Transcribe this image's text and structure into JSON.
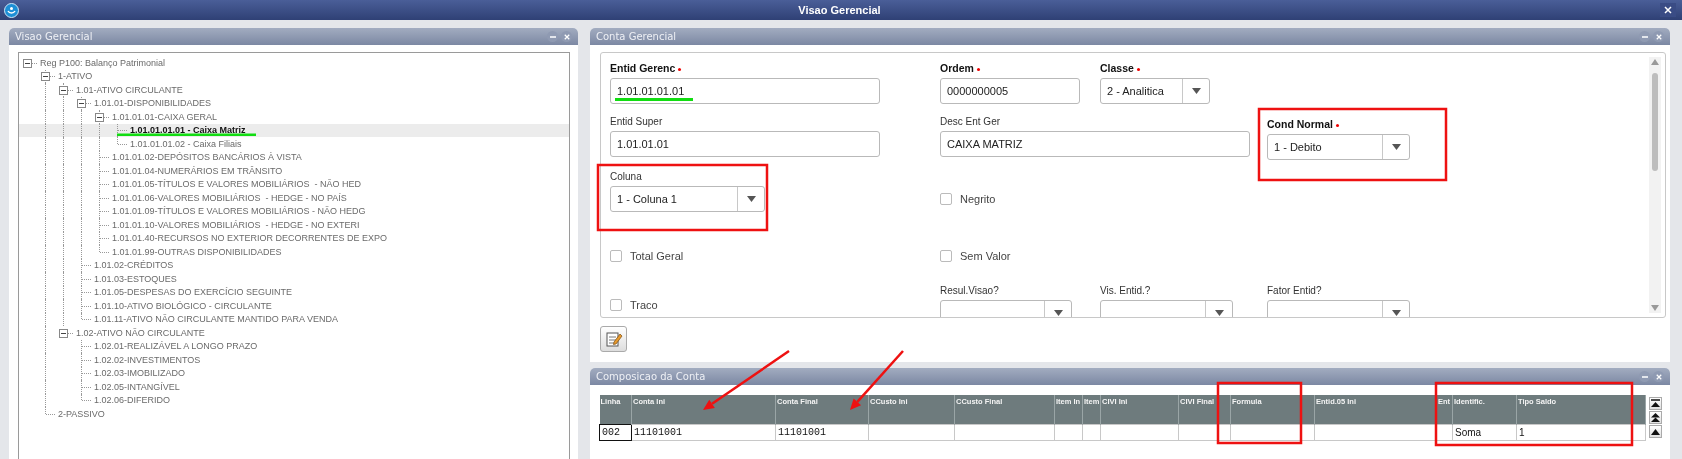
{
  "window": {
    "title": "Visao Gerencial"
  },
  "tree_panel": {
    "title": "Visao Gerencial",
    "tree": [
      {
        "label": "Reg P100: Balanço Patrimonial",
        "expanded": true,
        "selected": false,
        "children": [
          {
            "label": "1-ATIVO",
            "expanded": true,
            "selected": false,
            "children": [
              {
                "label": "1.01-ATIVO CIRCULANTE",
                "expanded": true,
                "selected": false,
                "children": [
                  {
                    "label": "1.01.01-DISPONIBILIDADES",
                    "expanded": true,
                    "selected": false,
                    "children": [
                      {
                        "label": "1.01.01.01-CAIXA GERAL",
                        "expanded": true,
                        "selected": false,
                        "children": [
                          {
                            "label": "1.01.01.01.01 - Caixa Matriz",
                            "selected": true
                          },
                          {
                            "label": "1.01.01.01.02 - Caixa Filiais",
                            "selected": false
                          }
                        ]
                      },
                      {
                        "label": "1.01.01.02-DEPÓSITOS BANCÁRIOS À VISTA",
                        "selected": false
                      },
                      {
                        "label": "1.01.01.04-NUMERÁRIOS EM TRÂNSITO",
                        "selected": false
                      },
                      {
                        "label": "1.01.01.05-TÍTULOS E VALORES MOBILIÁRIOS  - NÃO HED",
                        "selected": false
                      },
                      {
                        "label": "1.01.01.06-VALORES MOBILIÁRIOS  - HEDGE - NO PAÍS",
                        "selected": false
                      },
                      {
                        "label": "1.01.01.09-TÍTULOS E VALORES MOBILIÁRIOS - NÃO HEDG",
                        "selected": false
                      },
                      {
                        "label": "1.01.01.10-VALORES MOBILIÁRIOS  - HEDGE - NO EXTERI",
                        "selected": false
                      },
                      {
                        "label": "1.01.01.40-RECURSOS NO EXTERIOR DECORRENTES DE EXPO",
                        "selected": false
                      },
                      {
                        "label": "1.01.01.99-OUTRAS DISPONIBILIDADES",
                        "selected": false
                      }
                    ]
                  },
                  {
                    "label": "1.01.02-CRÉDITOS",
                    "selected": false
                  },
                  {
                    "label": "1.01.03-ESTOQUES",
                    "selected": false
                  },
                  {
                    "label": "1.01.05-DESPESAS DO EXERCÍCIO SEGUINTE",
                    "selected": false
                  },
                  {
                    "label": "1.01.10-ATIVO BIOLÓGICO - CIRCULANTE",
                    "selected": false
                  },
                  {
                    "label": "1.01.11-ATIVO NÃO CIRCULANTE MANTIDO PARA VENDA",
                    "selected": false
                  }
                ]
              },
              {
                "label": "1.02-ATIVO NÃO CIRCULANTE",
                "expanded": true,
                "selected": false,
                "children": [
                  {
                    "label": "1.02.01-REALIZÁVEL A LONGO PRAZO",
                    "selected": false
                  },
                  {
                    "label": "1.02.02-INVESTIMENTOS",
                    "selected": false
                  },
                  {
                    "label": "1.02.03-IMOBILIZADO",
                    "selected": false
                  },
                  {
                    "label": "1.02.05-INTANGÍVEL",
                    "selected": false
                  },
                  {
                    "label": "1.02.06-DIFERIDO",
                    "selected": false
                  }
                ]
              }
            ]
          },
          {
            "label": "2-PASSIVO",
            "selected": false
          }
        ]
      }
    ]
  },
  "account_panel": {
    "title": "Conta Gerencial",
    "fields": [
      {
        "kind": "text",
        "label": "Entid Gerenc",
        "required": true,
        "value": "1.01.01.01.01"
      },
      {
        "kind": "text",
        "label": "Ordem",
        "required": true,
        "value": "0000000005"
      },
      {
        "kind": "select",
        "label": "Classe",
        "required": true,
        "value": "2 - Analitica"
      },
      {
        "kind": "text",
        "label": "Entid Super",
        "required": false,
        "value": "1.01.01.01"
      },
      {
        "kind": "text",
        "label": "Desc Ent Ger",
        "required": false,
        "value": "CAIXA MATRIZ"
      },
      {
        "kind": "select",
        "label": "Cond Normal",
        "required": true,
        "value": "1 - Debito"
      },
      {
        "kind": "select",
        "label": "Coluna",
        "required": false,
        "value": "1 - Coluna 1"
      },
      {
        "kind": "checkbox",
        "label": "Negrito",
        "checked": false
      },
      {
        "kind": "checkbox",
        "label": "Total Geral",
        "checked": false
      },
      {
        "kind": "checkbox",
        "label": "Sem Valor",
        "checked": false
      },
      {
        "kind": "select",
        "label": "Resul.Visao?",
        "required": false
      },
      {
        "kind": "select",
        "label": "Vis. Entid.?",
        "required": false
      },
      {
        "kind": "select",
        "label": "Fator Entid?",
        "required": false
      },
      {
        "kind": "checkbox",
        "label": "Traco",
        "checked": false
      }
    ]
  },
  "composition_panel": {
    "title": "Composicao da Conta",
    "columns": [
      "Linha",
      "Conta Ini",
      "Conta Final",
      "CCusto Ini",
      "CCusto Final",
      "Item In",
      "Item",
      "CIVI Ini",
      "CIVI Final",
      "Formula",
      "Entid.05 Ini",
      "Ent",
      "Identific.",
      "Tipo Saldo"
    ],
    "rows": [
      {
        "cells": [
          {
            "text": "002",
            "focused": true
          },
          {
            "text": "11101001",
            "focused": false
          },
          {
            "text": "11101001",
            "focused": false
          },
          {
            "focused": false
          },
          {
            "focused": false
          },
          {
            "focused": false
          },
          {
            "focused": false
          },
          {
            "focused": false
          },
          {
            "focused": false
          },
          {
            "focused": false
          },
          {
            "focused": false
          },
          {
            "focused": false
          },
          {
            "text": "Soma",
            "focused": false
          },
          {
            "text": "1",
            "focused": false
          }
        ]
      }
    ]
  }
}
